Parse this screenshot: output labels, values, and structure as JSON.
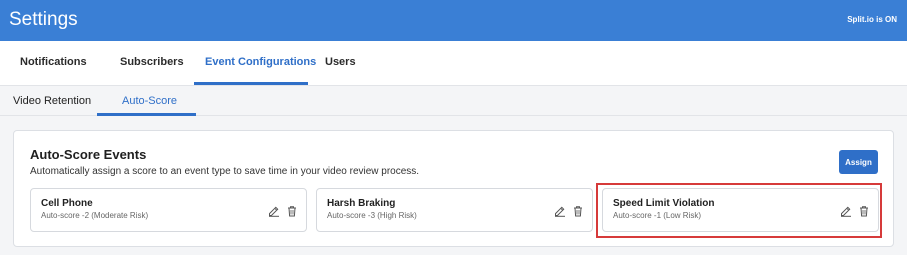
{
  "header": {
    "title": "Settings",
    "status": "Split.io is ON"
  },
  "tabs": [
    {
      "label": "Notifications",
      "active": false
    },
    {
      "label": "Subscribers",
      "active": false
    },
    {
      "label": "Event Configurations",
      "active": true
    },
    {
      "label": "Users",
      "active": false
    }
  ],
  "subtabs": [
    {
      "label": "Video Retention",
      "active": false
    },
    {
      "label": "Auto-Score",
      "active": true
    }
  ],
  "panel": {
    "title": "Auto-Score Events",
    "description": "Automatically assign a score to an event type to save time in your video review process.",
    "assign_label": "Assign"
  },
  "cards": [
    {
      "title": "Cell Phone",
      "subtitle": "Auto-score -2 (Moderate Risk)",
      "edit_icon": "edit-icon",
      "delete_icon": "trash-icon"
    },
    {
      "title": "Harsh Braking",
      "subtitle": "Auto-score -3 (High Risk)",
      "edit_icon": "edit-icon",
      "delete_icon": "trash-icon"
    },
    {
      "title": "Speed Limit Violation",
      "subtitle": "Auto-score -1 (Low Risk)",
      "edit_icon": "edit-icon",
      "delete_icon": "trash-icon",
      "highlighted": true
    }
  ],
  "colors": {
    "header": "#3a7fd5",
    "accent": "#2f6fc8",
    "highlight": "#d63a3a"
  }
}
